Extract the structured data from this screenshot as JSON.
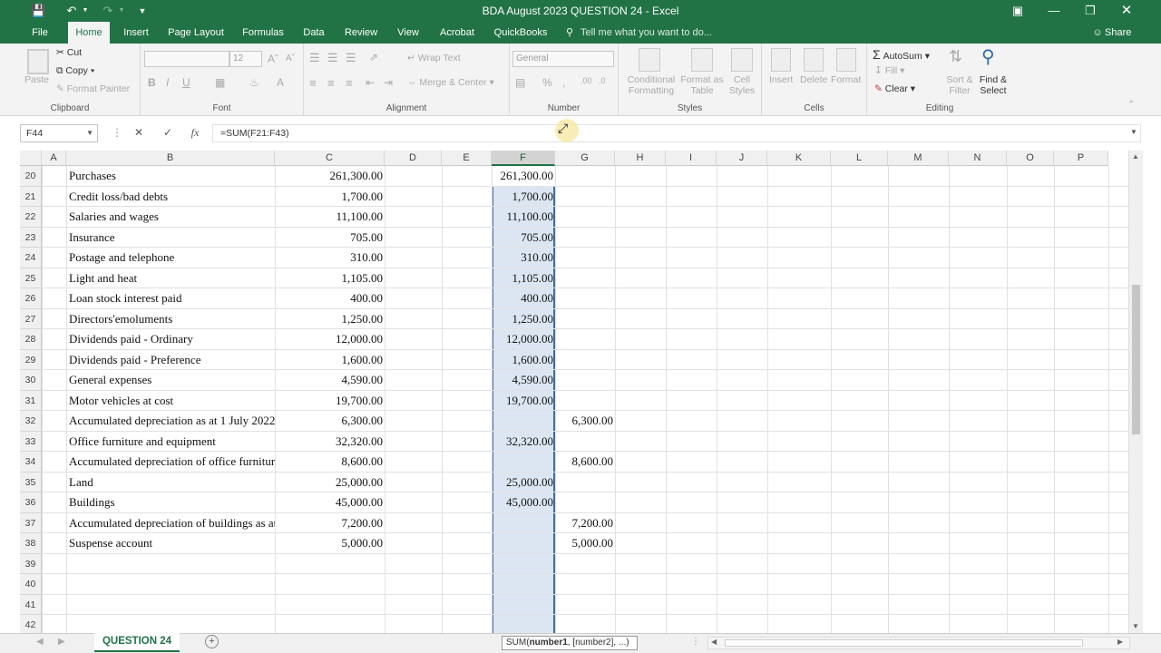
{
  "window": {
    "title": "BDA August 2023 QUESTION 24 - Excel"
  },
  "tabs": [
    "File",
    "Home",
    "Insert",
    "Page Layout",
    "Formulas",
    "Data",
    "Review",
    "View",
    "Acrobat",
    "QuickBooks"
  ],
  "tell_me": "Tell me what you want to do...",
  "share": "Share",
  "ribbon": {
    "clipboard": {
      "paste": "Paste",
      "cut": "Cut",
      "copy": "Copy",
      "painter": "Format Painter",
      "label": "Clipboard"
    },
    "font": {
      "size": "12",
      "bold": "B",
      "italic": "I",
      "underline": "U",
      "label": "Font"
    },
    "alignment": {
      "wrap": "Wrap Text",
      "merge": "Merge & Center",
      "label": "Alignment"
    },
    "number": {
      "format": "General",
      "label": "Number"
    },
    "styles": {
      "conditional": [
        "Conditional",
        "Formatting"
      ],
      "table": [
        "Format as",
        "Table"
      ],
      "cell": [
        "Cell",
        "Styles"
      ],
      "label": "Styles"
    },
    "cells": {
      "insert": "Insert",
      "delete": "Delete",
      "format": "Format",
      "label": "Cells"
    },
    "editing": {
      "autosum": "AutoSum",
      "fill": "Fill",
      "clear": "Clear",
      "sort": [
        "Sort &",
        "Filter"
      ],
      "find": [
        "Find &",
        "Select"
      ],
      "label": "Editing"
    }
  },
  "formula_bar": {
    "namebox": "F44",
    "formula": "=SUM(F21:F43)",
    "fx": "fx"
  },
  "columns": [
    "A",
    "B",
    "C",
    "D",
    "E",
    "F",
    "G",
    "H",
    "I",
    "J",
    "K",
    "L",
    "M",
    "N",
    "O",
    "P"
  ],
  "selected_column": "F",
  "rows": [
    {
      "num": "20",
      "b": "Purchases",
      "c": "261,300.00",
      "f": "261,300.00",
      "g": ""
    },
    {
      "num": "21",
      "b": "Credit loss/bad debts",
      "c": "1,700.00",
      "f": "1,700.00",
      "g": ""
    },
    {
      "num": "22",
      "b": "Salaries and wages",
      "c": "11,100.00",
      "f": "11,100.00",
      "g": ""
    },
    {
      "num": "23",
      "b": "Insurance",
      "c": "705.00",
      "f": "705.00",
      "g": ""
    },
    {
      "num": "24",
      "b": "Postage and telephone",
      "c": "310.00",
      "f": "310.00",
      "g": ""
    },
    {
      "num": "25",
      "b": "Light and heat",
      "c": "1,105.00",
      "f": "1,105.00",
      "g": ""
    },
    {
      "num": "26",
      "b": "Loan stock interest paid",
      "c": "400.00",
      "f": "400.00",
      "g": ""
    },
    {
      "num": "27",
      "b": "Directors'emoluments",
      "c": "1,250.00",
      "f": "1,250.00",
      "g": ""
    },
    {
      "num": "28",
      "b": "Dividends paid - Ordinary",
      "c": "12,000.00",
      "f": "12,000.00",
      "g": ""
    },
    {
      "num": "29",
      "b": "Dividends paid - Preference",
      "c": "1,600.00",
      "f": "1,600.00",
      "g": ""
    },
    {
      "num": "30",
      "b": "General expenses",
      "c": "4,590.00",
      "f": "4,590.00",
      "g": ""
    },
    {
      "num": "31",
      "b": "Motor vehicles at cost",
      "c": "19,700.00",
      "f": "19,700.00",
      "g": ""
    },
    {
      "num": "32",
      "b": "Accumulated depreciation as at 1 July 2022",
      "c": "6,300.00",
      "f": "",
      "g": "6,300.00"
    },
    {
      "num": "33",
      "b": "Office furniture and equipment",
      "c": "32,320.00",
      "f": "32,320.00",
      "g": ""
    },
    {
      "num": "34",
      "b": "Accumulated depreciation of office furniture",
      "c": "8,600.00",
      "f": "",
      "g": "8,600.00"
    },
    {
      "num": "35",
      "b": "Land",
      "c": "25,000.00",
      "f": "25,000.00",
      "g": ""
    },
    {
      "num": "36",
      "b": "Buildings",
      "c": "45,000.00",
      "f": "45,000.00",
      "g": ""
    },
    {
      "num": "37",
      "b": "Accumulated depreciation of buildings as at",
      "c": "7,200.00",
      "f": "",
      "g": "7,200.00"
    },
    {
      "num": "38",
      "b": "Suspense account",
      "c": "5,000.00",
      "f": "",
      "g": "5,000.00"
    },
    {
      "num": "39",
      "b": "",
      "c": "",
      "f": "",
      "g": ""
    },
    {
      "num": "40",
      "b": "",
      "c": "",
      "f": "",
      "g": ""
    },
    {
      "num": "41",
      "b": "",
      "c": "",
      "f": "",
      "g": ""
    },
    {
      "num": "42",
      "b": "",
      "c": "",
      "f": "",
      "g": ""
    }
  ],
  "sheet": {
    "tab": "QUESTION 24",
    "tooltip_fn": "SUM(",
    "tooltip_arg1": "number1",
    ", [number2], ...)": "",
    "tooltip_rest": ", [number2], ...)"
  }
}
